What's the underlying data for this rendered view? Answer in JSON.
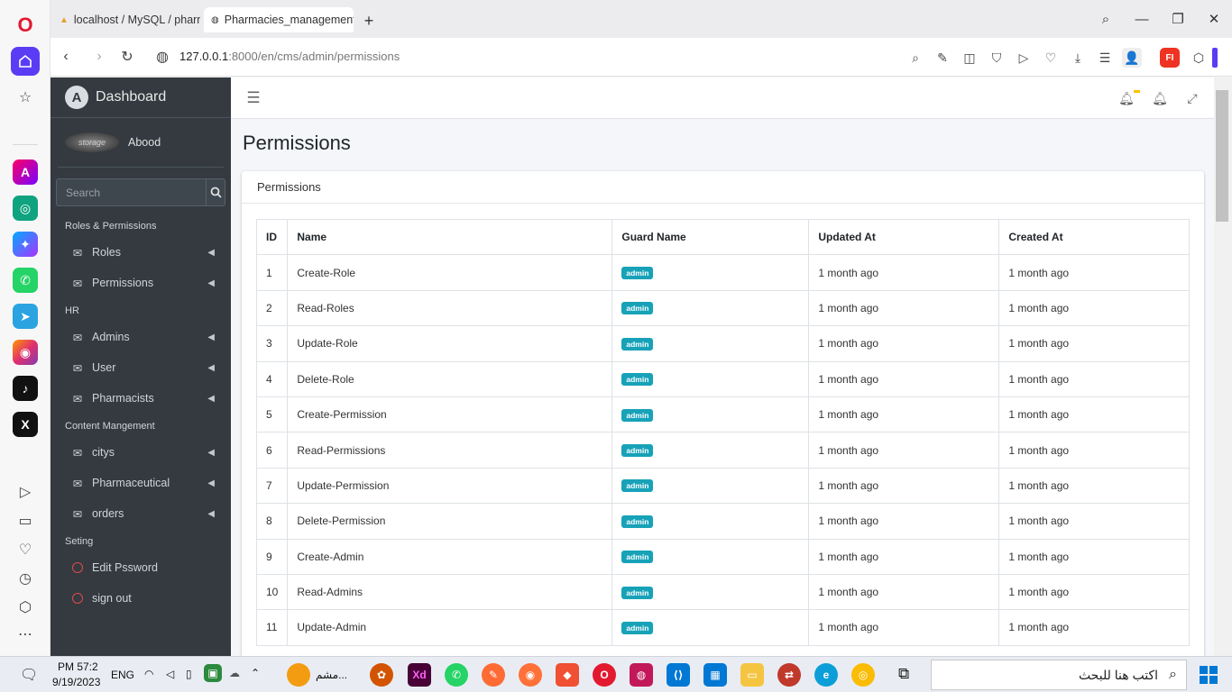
{
  "browser": {
    "tabs": [
      {
        "label": "localhost / MySQL / pharm",
        "icon": "phpmyadmin-icon"
      },
      {
        "label": "Pharmacies_management",
        "icon": "globe-icon"
      }
    ],
    "url_host": "127.0.0.1",
    "url_rest": ":8000/en/cms/admin/permissions"
  },
  "sidebar": {
    "brand": "Dashboard",
    "user_name": "Abood",
    "avatar_text": "storage",
    "search_placeholder": "Search",
    "sections": [
      {
        "header": "Roles & Permissions"
      },
      {
        "header": "HR"
      },
      {
        "header": "Content Mangement"
      },
      {
        "header": "Seting"
      }
    ],
    "items": {
      "roles": "Roles",
      "permissions": "Permissions",
      "admins": "Admins",
      "user": "User",
      "pharmacists": "Pharmacists",
      "citys": "citys",
      "pharmaceutical": "Pharmaceutical",
      "orders": "orders",
      "edit_password": "Edit Pssword",
      "sign_out": "sign out"
    }
  },
  "page": {
    "title": "Permissions",
    "card_title": "Permissions",
    "columns": [
      "ID",
      "Name",
      "Guard Name",
      "Updated At",
      "Created At"
    ],
    "rows": [
      {
        "id": "1",
        "name": "Create-Role",
        "guard": "admin",
        "updated": "1 month ago",
        "created": "1 month ago"
      },
      {
        "id": "2",
        "name": "Read-Roles",
        "guard": "admin",
        "updated": "1 month ago",
        "created": "1 month ago"
      },
      {
        "id": "3",
        "name": "Update-Role",
        "guard": "admin",
        "updated": "1 month ago",
        "created": "1 month ago"
      },
      {
        "id": "4",
        "name": "Delete-Role",
        "guard": "admin",
        "updated": "1 month ago",
        "created": "1 month ago"
      },
      {
        "id": "5",
        "name": "Create-Permission",
        "guard": "admin",
        "updated": "1 month ago",
        "created": "1 month ago"
      },
      {
        "id": "6",
        "name": "Read-Permissions",
        "guard": "admin",
        "updated": "1 month ago",
        "created": "1 month ago"
      },
      {
        "id": "7",
        "name": "Update-Permission",
        "guard": "admin",
        "updated": "1 month ago",
        "created": "1 month ago"
      },
      {
        "id": "8",
        "name": "Delete-Permission",
        "guard": "admin",
        "updated": "1 month ago",
        "created": "1 month ago"
      },
      {
        "id": "9",
        "name": "Create-Admin",
        "guard": "admin",
        "updated": "1 month ago",
        "created": "1 month ago"
      },
      {
        "id": "10",
        "name": "Read-Admins",
        "guard": "admin",
        "updated": "1 month ago",
        "created": "1 month ago"
      },
      {
        "id": "11",
        "name": "Update-Admin",
        "guard": "admin",
        "updated": "1 month ago",
        "created": "1 month ago"
      }
    ]
  },
  "taskbar": {
    "time": "PM 57:2",
    "date": "9/19/2023",
    "lang": "ENG",
    "search_placeholder": "اكتب هنا للبحث",
    "running_app_label": "مشم..."
  },
  "colors": {
    "sidebar_bg": "#343a40",
    "badge": "#17a2b8",
    "opera_accent": "#5b3cf5"
  }
}
